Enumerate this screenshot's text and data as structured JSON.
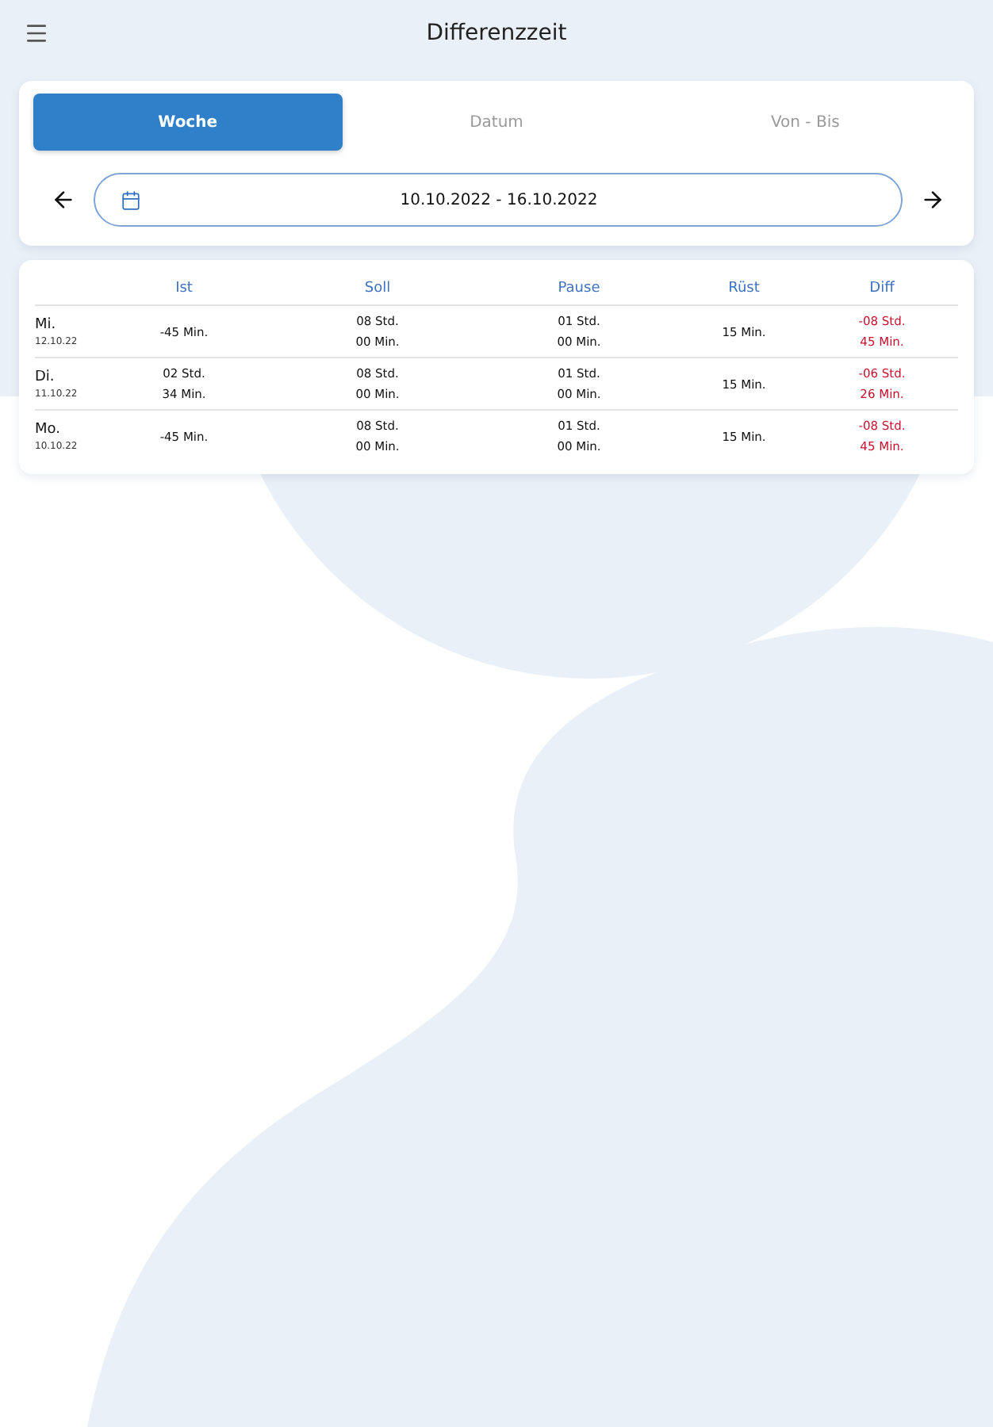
{
  "app_bar": {
    "title": "Differenzzeit"
  },
  "tabs": [
    {
      "label": "Woche",
      "selected": true
    },
    {
      "label": "Datum",
      "selected": false
    },
    {
      "label": "Von - Bis",
      "selected": false
    }
  ],
  "date_range": {
    "value": "10.10.2022 - 16.10.2022"
  },
  "table": {
    "columns": [
      "Ist",
      "Soll",
      "Pause",
      "Rüst",
      "Diff"
    ],
    "rows": [
      {
        "day": "Mi.",
        "date": "12.10.22",
        "negative": true,
        "cells": [
          [
            "-45 Min."
          ],
          [
            "08 Std.",
            "00 Min."
          ],
          [
            "01 Std.",
            "00 Min."
          ],
          [
            "15 Min."
          ],
          [
            "-08 Std.",
            "45 Min."
          ]
        ]
      },
      {
        "day": "Di.",
        "date": "11.10.22",
        "negative": true,
        "cells": [
          [
            "02 Std.",
            "34 Min."
          ],
          [
            "08 Std.",
            "00 Min."
          ],
          [
            "01 Std.",
            "00 Min."
          ],
          [
            "15 Min."
          ],
          [
            "-06 Std.",
            "26 Min."
          ]
        ]
      },
      {
        "day": "Mo.",
        "date": "10.10.22",
        "negative": true,
        "cells": [
          [
            "-45 Min."
          ],
          [
            "08 Std.",
            "00 Min."
          ],
          [
            "01 Std.",
            "00 Min."
          ],
          [
            "15 Min."
          ],
          [
            "-08 Std.",
            "45 Min."
          ]
        ]
      }
    ]
  }
}
